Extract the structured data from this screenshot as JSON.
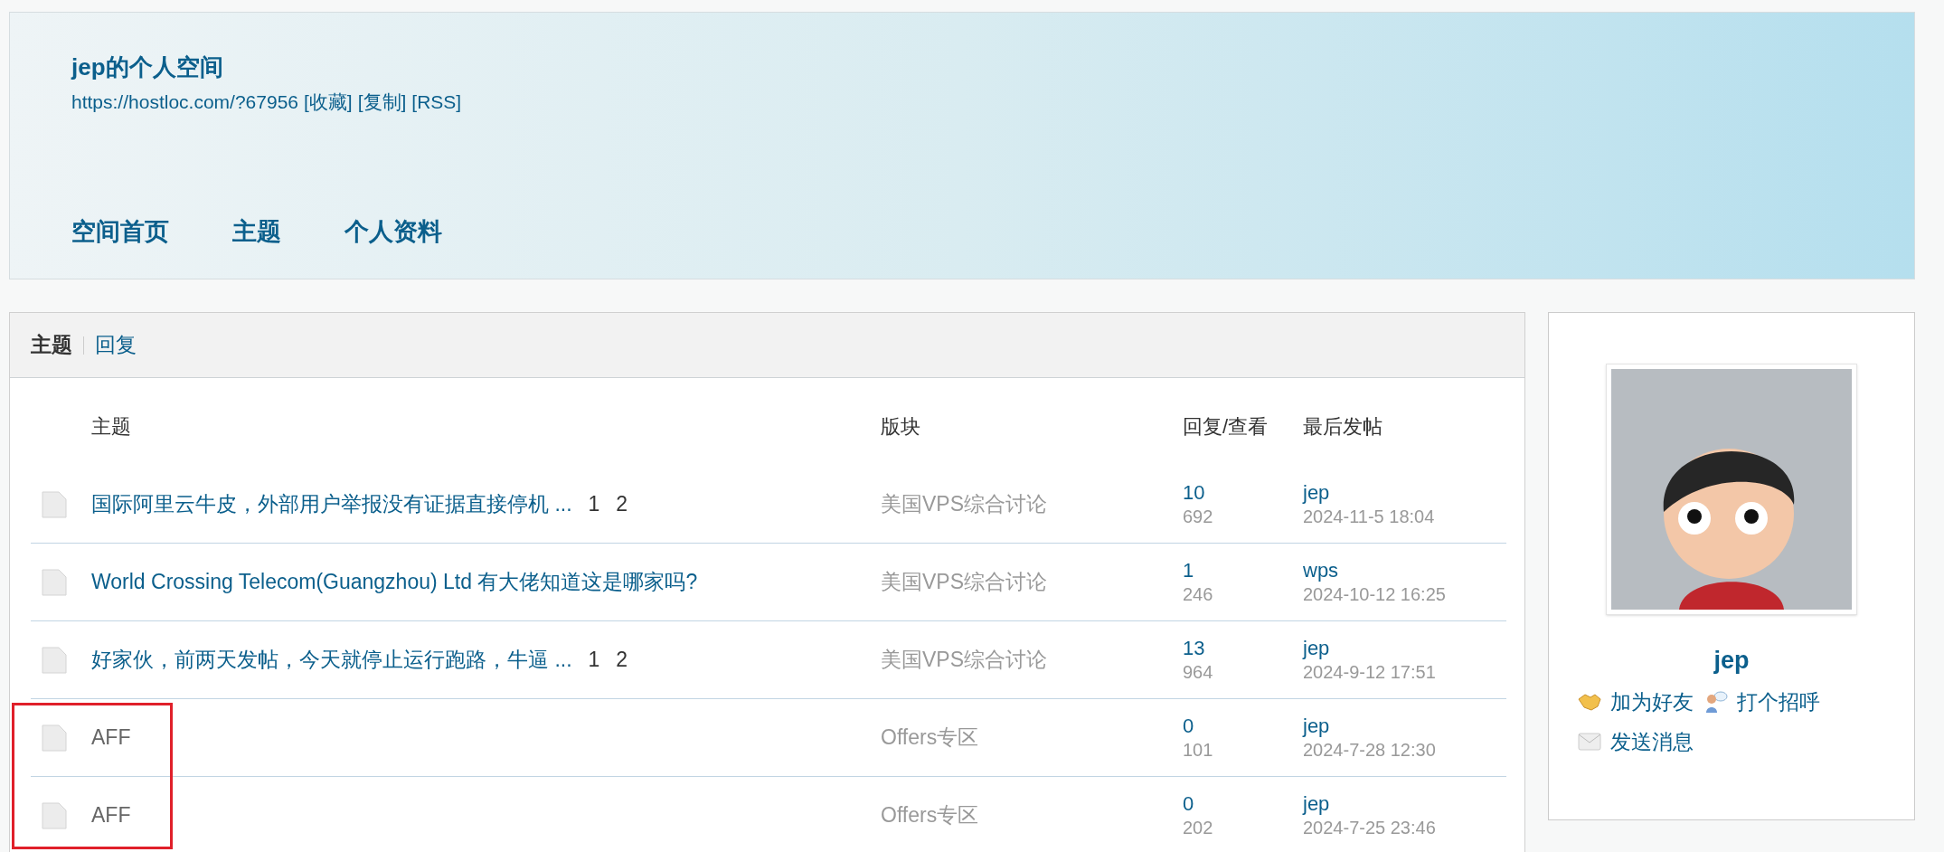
{
  "header": {
    "title": "jep的个人空间",
    "url": "https://hostloc.com/?67956",
    "links": [
      "[收藏]",
      "[复制]",
      "[RSS]"
    ],
    "nav": [
      "空间首页",
      "主题",
      "个人资料"
    ]
  },
  "tabs": [
    {
      "label": "主题",
      "selected": true
    },
    {
      "label": "回复",
      "selected": false
    }
  ],
  "table": {
    "columns": [
      "主题",
      "版块",
      "回复/查看",
      "最后发帖"
    ],
    "rows": [
      {
        "title": "国际阿里云牛皮，外部用户举报没有证据直接停机 ...",
        "pages": [
          "1",
          "2"
        ],
        "greyed": false,
        "marked": false,
        "forum": "美国VPS综合讨论",
        "replies": "10",
        "views": "692",
        "last_user": "jep",
        "last_time": "2024-11-5 18:04"
      },
      {
        "title": "World Crossing Telecom(Guangzhou) Ltd 有大佬知道这是哪家吗?",
        "pages": [],
        "greyed": false,
        "marked": false,
        "forum": "美国VPS综合讨论",
        "replies": "1",
        "views": "246",
        "last_user": "wps",
        "last_time": "2024-10-12 16:25"
      },
      {
        "title": "好家伙，前两天发帖，今天就停止运行跑路，牛逼 ...",
        "pages": [
          "1",
          "2"
        ],
        "greyed": false,
        "marked": false,
        "forum": "美国VPS综合讨论",
        "replies": "13",
        "views": "964",
        "last_user": "jep",
        "last_time": "2024-9-12 17:51"
      },
      {
        "title": "AFF",
        "pages": [],
        "greyed": true,
        "marked": true,
        "forum": "Offers专区",
        "replies": "0",
        "views": "101",
        "last_user": "jep",
        "last_time": "2024-7-28 12:30"
      },
      {
        "title": "AFF",
        "pages": [],
        "greyed": true,
        "marked": true,
        "forum": "Offers专区",
        "replies": "0",
        "views": "202",
        "last_user": "jep",
        "last_time": "2024-7-25 23:46"
      }
    ]
  },
  "profile": {
    "name": "jep",
    "actions": [
      {
        "kind": "friend",
        "label": "加为好友"
      },
      {
        "kind": "poke",
        "label": "打个招呼"
      },
      {
        "kind": "message",
        "label": "发送消息"
      }
    ]
  }
}
